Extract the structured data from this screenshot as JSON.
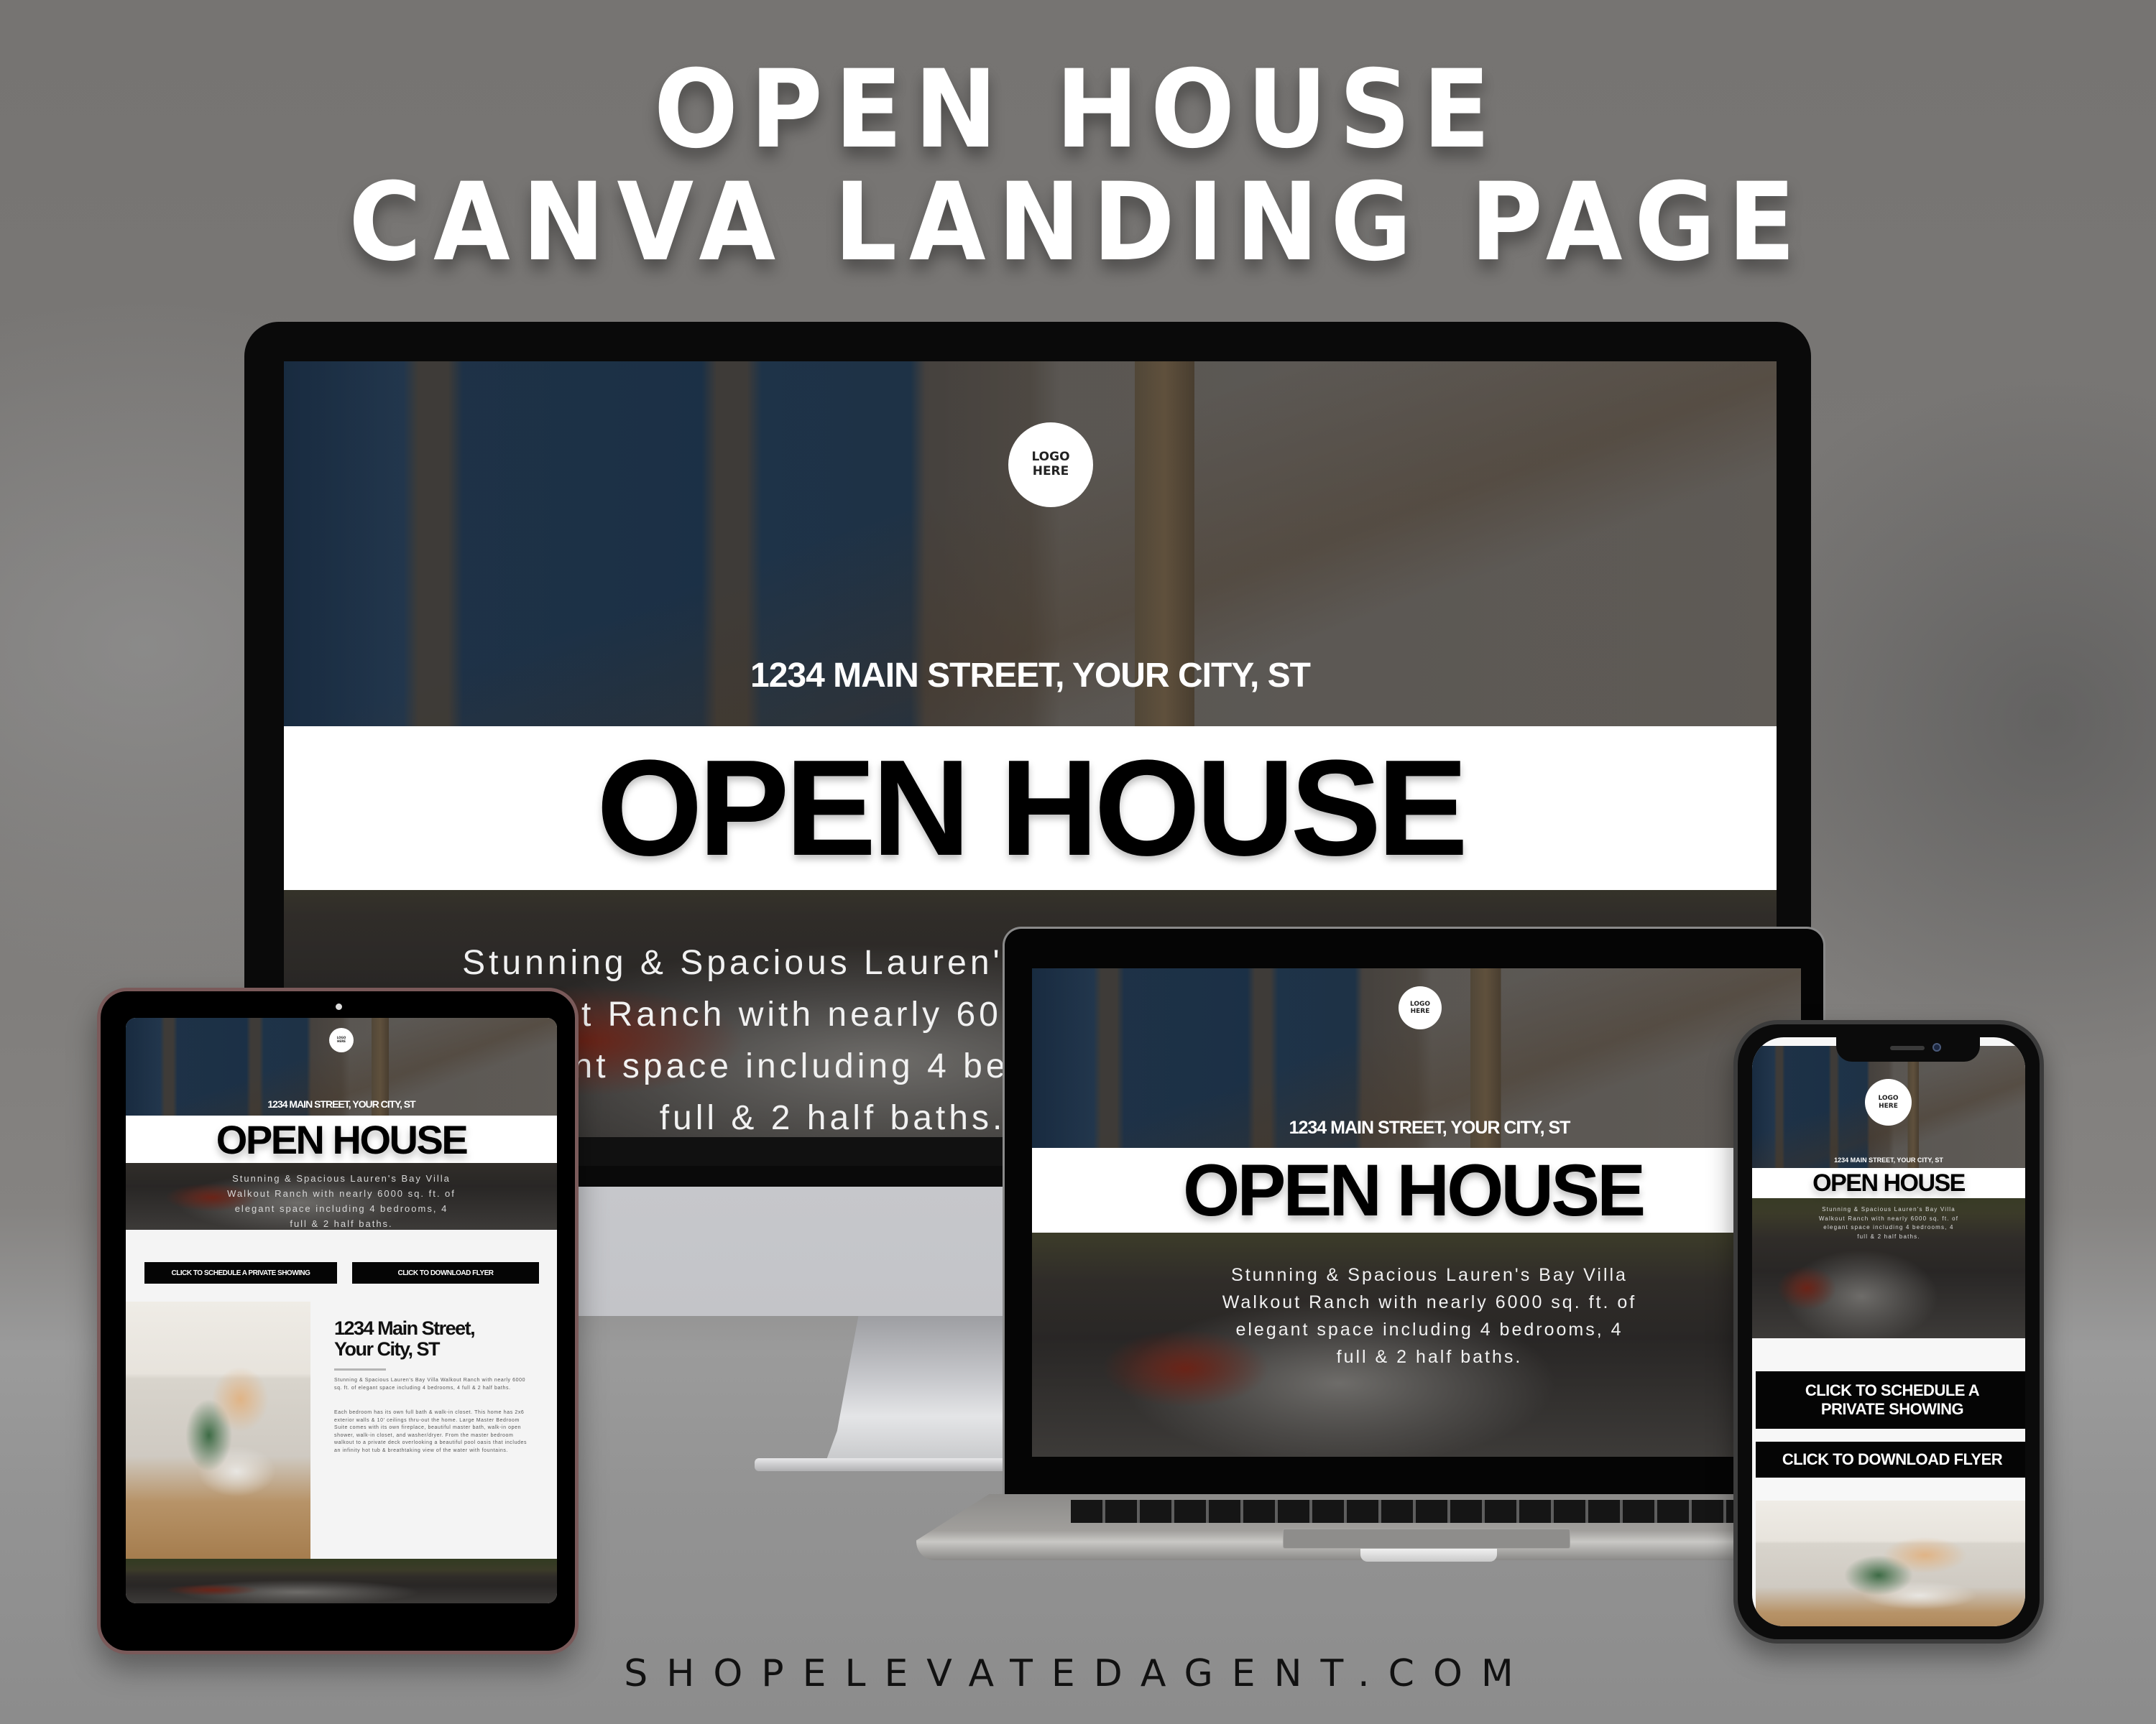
{
  "promo": {
    "headline_line1": "OPEN HOUSE",
    "headline_line2": "CANVA LANDING PAGE",
    "footer_url": "SHOPELEVATEDAGENT.COM"
  },
  "landing_page": {
    "logo_line1": "LOGO",
    "logo_line2": "HERE",
    "address_caps": "1234 MAIN STREET, YOUR CITY, ST",
    "banner_title": "OPEN HOUSE",
    "description": "Stunning & Spacious Lauren's Bay Villa Walkout Ranch with nearly 6000 sq. ft. of elegant space including 4 bedrooms, 4 full & 2 half baths.",
    "description_lines": [
      "Stunning & Spacious Lauren's Bay Villa",
      "Walkout Ranch with nearly 6000 sq. ft. of",
      "elegant space including 4 bedrooms, 4",
      "full & 2 half baths."
    ],
    "desktop_visible_description_lines": [
      "Stunning & Spacio",
      "Walkout Ranch with",
      "elegant space incl",
      "full & 2 I"
    ],
    "buttons": {
      "schedule_showing": "CLICK TO SCHEDULE A PRIVATE SHOWING",
      "schedule_showing_line1": "CLICK TO SCHEDULE A",
      "schedule_showing_line2": "PRIVATE SHOWING",
      "download_flyer": "CLICK TO DOWNLOAD FLYER"
    },
    "detail": {
      "address_line1": "1234 Main Street,",
      "address_line2": "Your City, ST",
      "paragraph1": "Stunning & Spacious Lauren's Bay Villa Walkout Ranch with nearly 6000 sq. ft. of elegant space including 4 bedrooms, 4 full & 2 half baths.",
      "paragraph2": "Each bedroom has its own full bath & walk-in closet. This home has 2x6 exterior walls & 10' ceilings thru-out the home. Large Master Bedroom Suite comes with its own fireplace, beautiful master bath, walk-in open shower, walk-in closet, and washer/dryer. From the master bedroom walkout to a private deck overlooking a beautiful pool oasis that includes an infinity hot tub & breathtaking view of the water with fountains."
    }
  },
  "devices": [
    "desktop-monitor",
    "laptop",
    "tablet",
    "phone"
  ],
  "colors": {
    "banner_bg": "#ffffff",
    "banner_text": "#000000",
    "button_bg": "#050505",
    "button_text": "#ffffff",
    "tablet_frame": "#7a5a5a"
  }
}
